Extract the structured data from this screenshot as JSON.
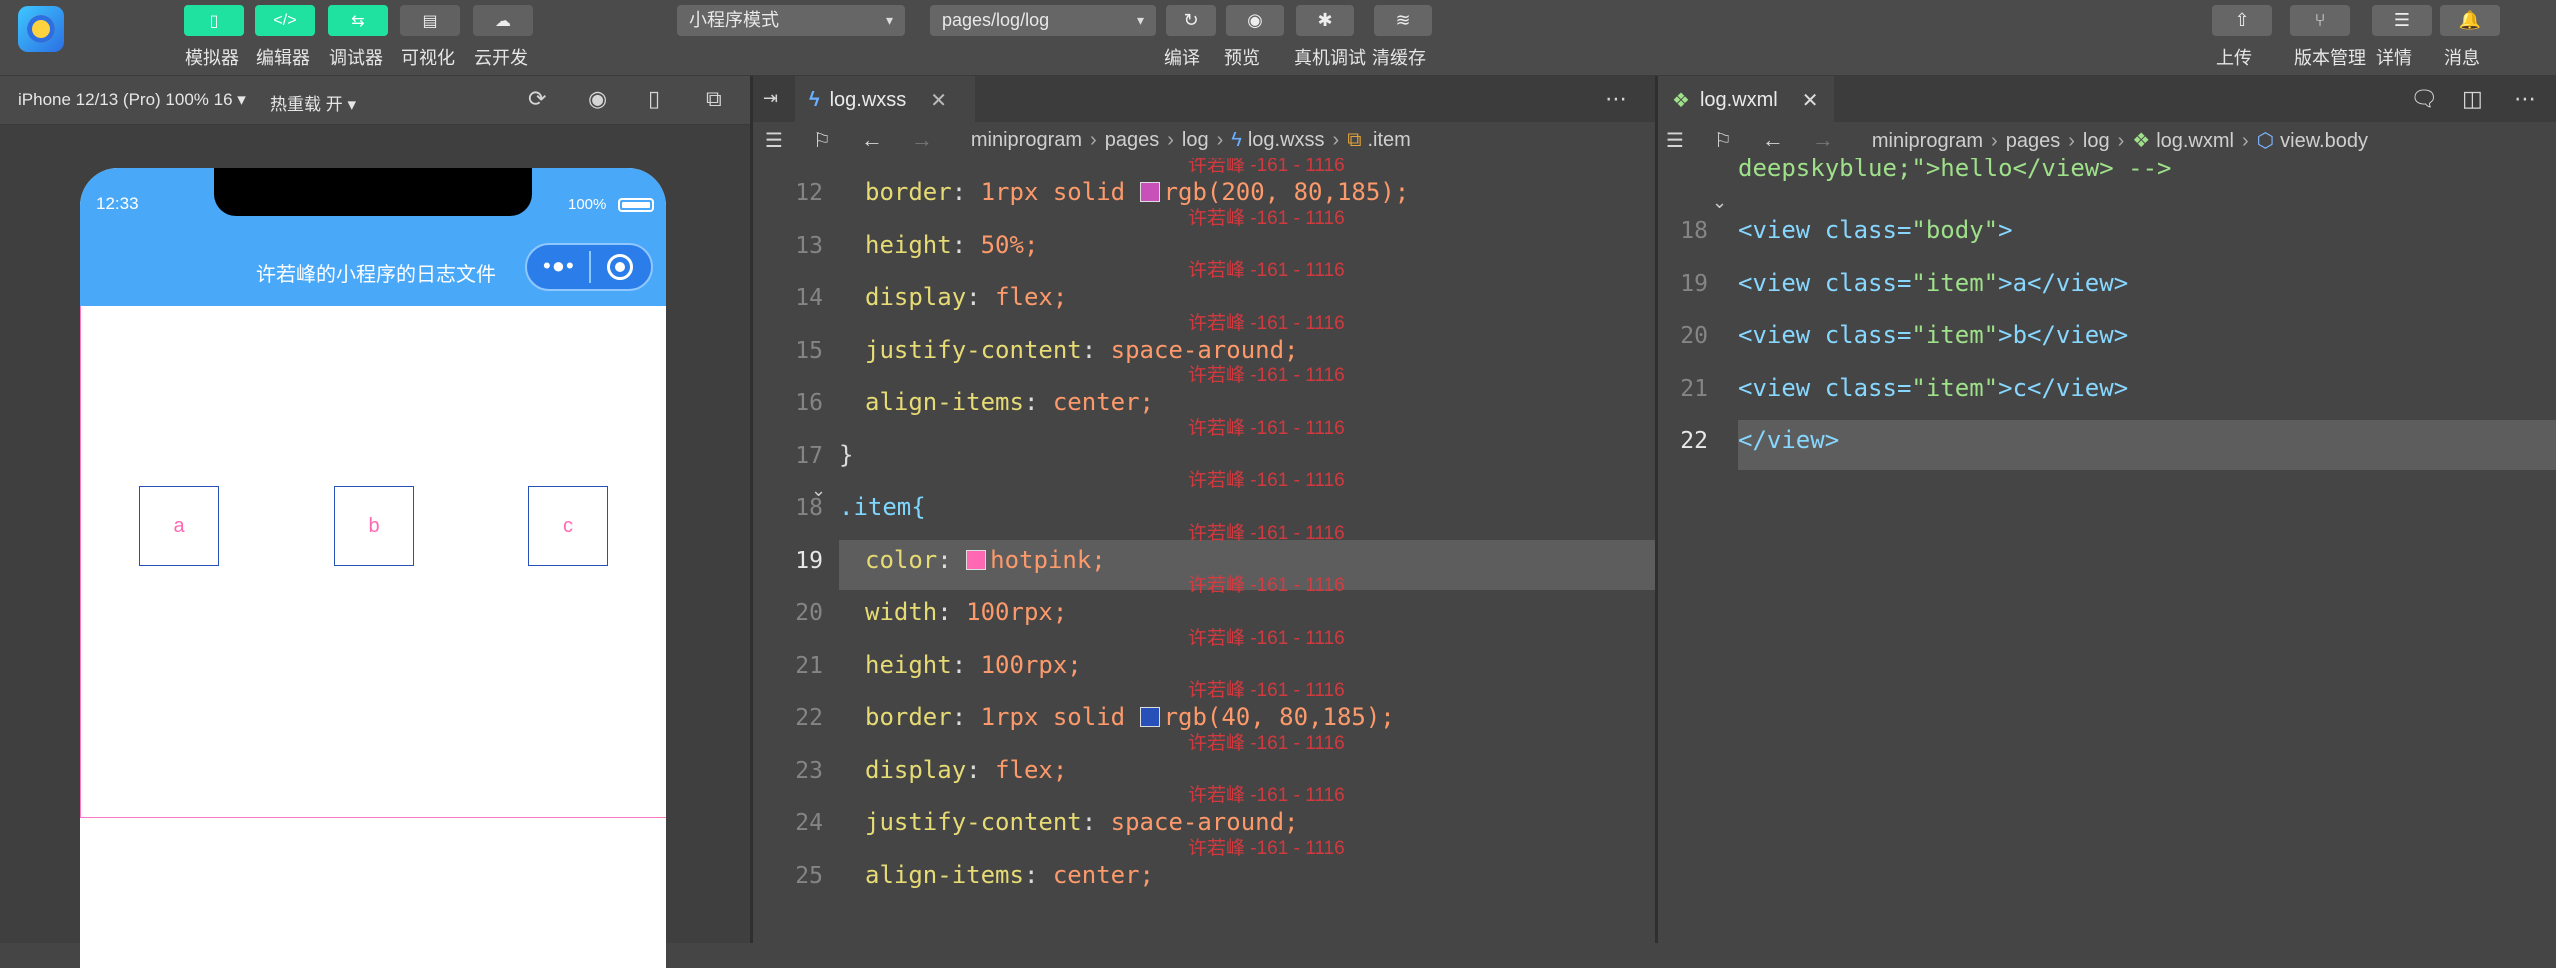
{
  "toolbar": {
    "buttons": [
      {
        "label": "模拟器",
        "icon": "phone-icon",
        "glyph": "▯"
      },
      {
        "label": "编辑器",
        "icon": "code-icon",
        "glyph": "</>"
      },
      {
        "label": "调试器",
        "icon": "debug-icon",
        "glyph": "⇆"
      },
      {
        "label": "可视化",
        "icon": "layout-icon",
        "glyph": "▤"
      },
      {
        "label": "云开发",
        "icon": "cloud-icon",
        "glyph": "☁"
      }
    ],
    "mode_select": "小程序模式",
    "page_select": "pages/log/log",
    "actions": [
      {
        "label": "编译",
        "glyph": "↻"
      },
      {
        "label": "预览",
        "glyph": "◉"
      },
      {
        "label": "真机调试",
        "glyph": "✱"
      },
      {
        "label": "清缓存",
        "glyph": "≋"
      }
    ],
    "right_actions": [
      {
        "label": "上传",
        "glyph": "⇧"
      },
      {
        "label": "版本管理",
        "glyph": "⑂"
      },
      {
        "label": "详情",
        "glyph": "☰"
      },
      {
        "label": "消息",
        "glyph": "🔔"
      }
    ]
  },
  "simulator": {
    "device": "iPhone 12/13 (Pro) 100% 16",
    "hot_reload": "热重载 开",
    "status_time": "12:33",
    "battery": "100%",
    "nav_title": "许若峰的小程序的日志文件",
    "items": [
      "a",
      "b",
      "c"
    ]
  },
  "editor_left": {
    "tab": "log.wxss",
    "breadcrumb": [
      "miniprogram",
      "pages",
      "log",
      "log.wxss",
      ".item"
    ],
    "watermark": "许若峰 -161 - 1116",
    "current_line": 19,
    "lines": [
      {
        "n": 12,
        "indent": true,
        "prop": "border",
        "val": "1rpx solid",
        "swatch": "#c850b9",
        "rest": "rgb(200, 80,185);"
      },
      {
        "n": 13,
        "indent": true,
        "prop": "height",
        "val": "50%;"
      },
      {
        "n": 14,
        "indent": true,
        "prop": "display",
        "val": "flex;"
      },
      {
        "n": 15,
        "indent": true,
        "prop": "justify-content",
        "val": "space-around;"
      },
      {
        "n": 16,
        "indent": true,
        "prop": "align-items",
        "val": "center;"
      },
      {
        "n": 17,
        "indent": false,
        "raw": "}"
      },
      {
        "n": 18,
        "indent": false,
        "raw": ".item{"
      },
      {
        "n": 19,
        "indent": true,
        "prop": "color",
        "val": "",
        "swatch": "#ff69b4",
        "rest": "hotpink;"
      },
      {
        "n": 20,
        "indent": true,
        "prop": "width",
        "val": "100rpx;"
      },
      {
        "n": 21,
        "indent": true,
        "prop": "height",
        "val": "100rpx;"
      },
      {
        "n": 22,
        "indent": true,
        "prop": "border",
        "val": "1rpx solid",
        "swatch": "#2850b9",
        "rest": "rgb(40, 80,185);"
      },
      {
        "n": 23,
        "indent": true,
        "prop": "display",
        "val": "flex;"
      },
      {
        "n": 24,
        "indent": true,
        "prop": "justify-content",
        "val": "space-around;"
      },
      {
        "n": 25,
        "indent": true,
        "prop": "align-items",
        "val": "center;"
      }
    ]
  },
  "editor_right": {
    "tab": "log.wxml",
    "breadcrumb": [
      "miniprogram",
      "pages",
      "log",
      "log.wxml",
      "view.body"
    ],
    "top_fragment": "deepskyblue;\">hello</view> -->",
    "current_line": 22,
    "lines": [
      {
        "n": 18,
        "text": "<view class=\"body\">"
      },
      {
        "n": 19,
        "text": "<view class=\"item\">a</view>"
      },
      {
        "n": 20,
        "text": "<view class=\"item\">b</view>"
      },
      {
        "n": 21,
        "text": "<view class=\"item\">c</view>"
      },
      {
        "n": 22,
        "text": "</view>"
      }
    ]
  }
}
